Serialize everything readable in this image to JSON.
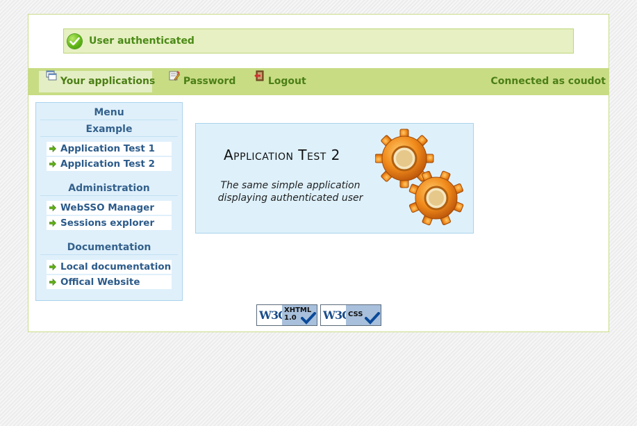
{
  "message": {
    "text": "User authenticated",
    "icon": "checkmark-circle-icon"
  },
  "menu": {
    "tabs": [
      {
        "label": "Your applications",
        "icon": "applications-icon",
        "active": true
      },
      {
        "label": "Password",
        "icon": "password-icon",
        "active": false
      },
      {
        "label": "Logout",
        "icon": "logout-icon",
        "active": false
      }
    ],
    "connected": "Connected as coudot"
  },
  "sidebar": {
    "title": "Menu",
    "sections": [
      {
        "title": "Example",
        "links": [
          "Application Test 1",
          "Application Test 2"
        ]
      },
      {
        "title": "Administration",
        "links": [
          "WebSSO Manager",
          "Sessions explorer"
        ]
      },
      {
        "title": "Documentation",
        "links": [
          "Local documentation",
          "Offical Website"
        ]
      }
    ]
  },
  "app_card": {
    "title": "Application Test 2",
    "description": "The same simple application displaying authenticated user",
    "icon": "gears-icon"
  },
  "badges": [
    {
      "logo": "W3C",
      "label_line1": "XHTML",
      "label_line2": "1.0"
    },
    {
      "logo": "W3C",
      "label_line1": "CSS",
      "label_line2": ""
    }
  ],
  "colors": {
    "accent_green": "#c8dc84",
    "text_green": "#4b7f15",
    "sidebar_blue": "#dff0fb",
    "link_blue": "#2c5b8a"
  }
}
